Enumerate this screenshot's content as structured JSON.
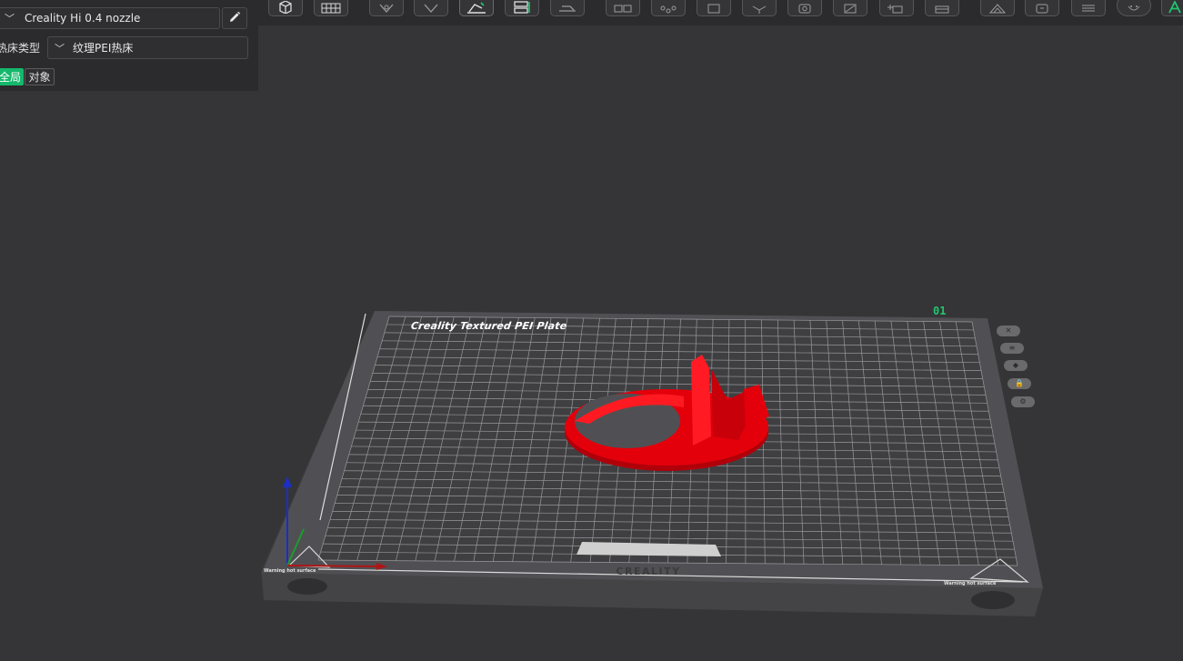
{
  "left_panel": {
    "nozzle": {
      "value": "Creality Hi 0.4 nozzle",
      "chevron_icon": "chevron-down-icon",
      "edit_icon": "pencil-icon"
    },
    "bed_type": {
      "label": "热床类型",
      "value": "纹理PEI热床"
    },
    "scope_tabs": [
      {
        "label": "全局",
        "active": true
      },
      {
        "label": "对象",
        "active": false
      }
    ]
  },
  "toolbar": {
    "tools": [
      {
        "icon": "cube-view-icon"
      },
      {
        "icon": "arrange-grid-icon"
      },
      {
        "icon": "rotate-icon"
      },
      {
        "icon": "orient-icon"
      },
      {
        "icon": "lay-on-face-icon"
      },
      {
        "icon": "split-icon"
      },
      {
        "icon": "cut-icon"
      },
      {
        "icon": "multi-part-icon"
      },
      {
        "icon": "support-paint-icon"
      },
      {
        "icon": "boundary-icon"
      },
      {
        "icon": "measure-icon"
      },
      {
        "icon": "hollow-icon"
      },
      {
        "icon": "slice-plane-icon"
      },
      {
        "icon": "add-part-icon"
      },
      {
        "icon": "layer-icon"
      },
      {
        "icon": "assembly-icon"
      },
      {
        "icon": "shell-icon"
      },
      {
        "icon": "layers-list-icon"
      },
      {
        "icon": "seam-icon"
      },
      {
        "icon": "text-tool-icon"
      }
    ]
  },
  "viewport": {
    "plate_label": "Creality Textured PEI Plate",
    "plate_number": "01",
    "brand_label": "CREALITY",
    "warning_text": "Warning hot surface",
    "model_color": "#e3000b",
    "accent_color": "#21c56f",
    "plate_buttons": [
      {
        "icon": "close-icon",
        "glyph": "✕"
      },
      {
        "icon": "arrange-icon",
        "glyph": "≡"
      },
      {
        "icon": "orient-plate-icon",
        "glyph": "◆"
      },
      {
        "icon": "lock-icon",
        "glyph": "🔒"
      },
      {
        "icon": "settings-icon",
        "glyph": "⚙"
      }
    ]
  }
}
